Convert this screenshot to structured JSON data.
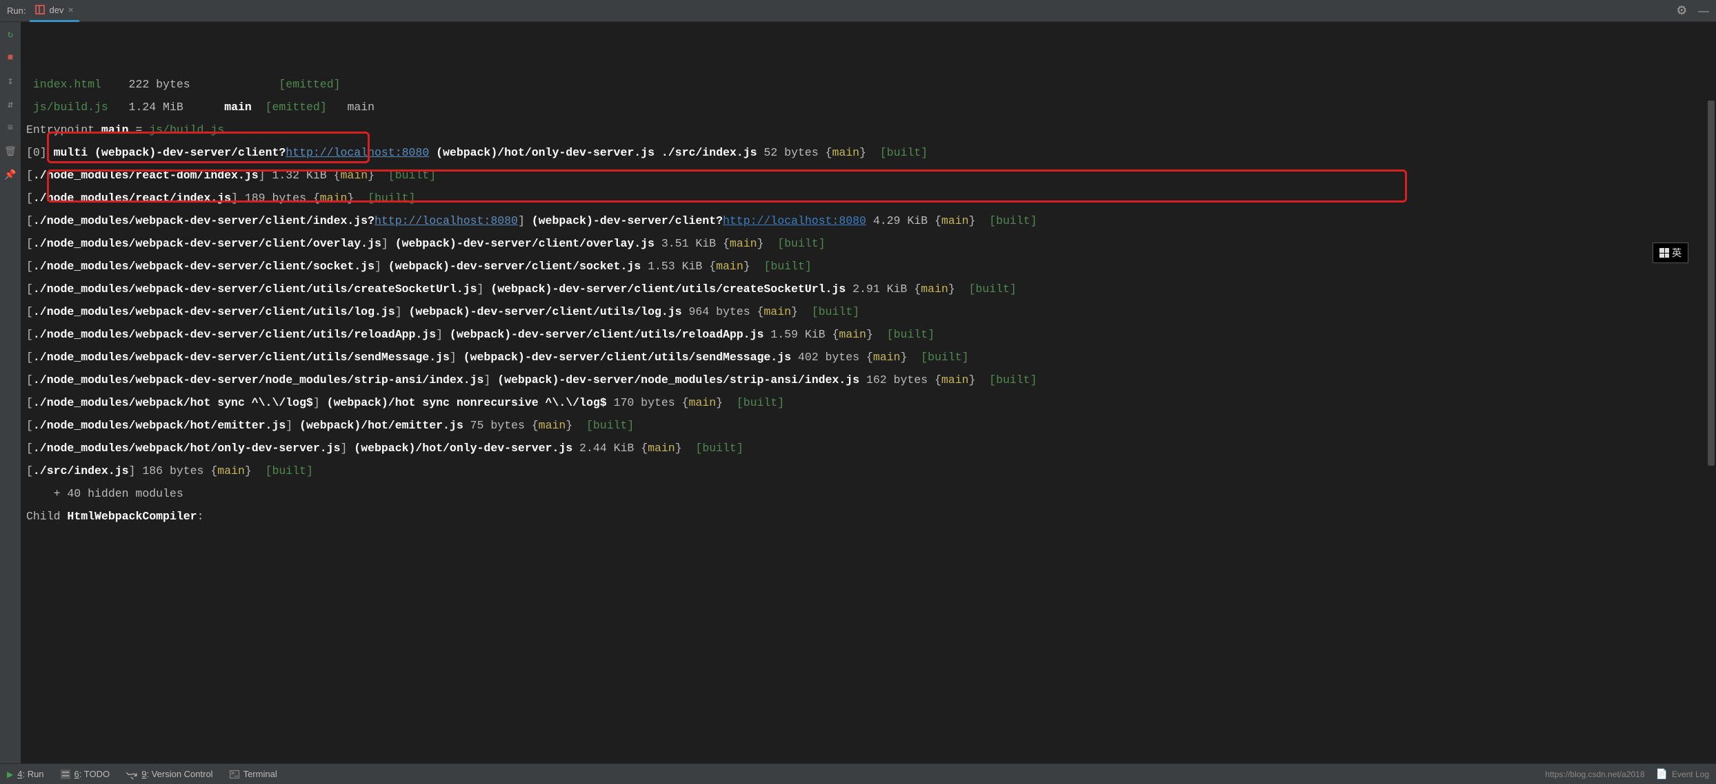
{
  "topBar": {
    "runLabel": "Run:",
    "tab": {
      "name": "dev",
      "closeGlyph": "×"
    },
    "gearGlyph": "⚙",
    "minimizeGlyph": "—"
  },
  "gutter": {
    "rerun": "↻",
    "stop": "■",
    "down": "↧",
    "layout": "⇵",
    "stack": "≡",
    "trash": "🗑",
    "pin": "📌"
  },
  "ime": {
    "label": "英"
  },
  "console": {
    "assets": [
      {
        "name": "index.html",
        "size": "222 bytes",
        "chunk": "",
        "status": "[emitted]",
        "extra": ""
      },
      {
        "name": "js/build.js",
        "size": "1.24 MiB",
        "chunk": "main",
        "status": "[emitted]",
        "extra": "main"
      }
    ],
    "entrypoint": {
      "prefix": "Entrypoint ",
      "name": "main",
      "eq": " = ",
      "file": "js/build.js"
    },
    "multiLine": {
      "idx": "[0]",
      "pre": " multi (webpack)-dev-server/client?",
      "url": "http://localhost:8080",
      "mid": " (webpack)/hot/only-dev-server.js ./src/index.js",
      "size": " 52 bytes ",
      "chunk": "main",
      "status": "[built]"
    },
    "modules": [
      {
        "path": "./node_modules/react-dom/index.js",
        "alias": "",
        "url": "",
        "post": "",
        "size": " 1.32 KiB ",
        "chunk": "main",
        "status": "[built]"
      },
      {
        "path": "./node_modules/react/index.js",
        "alias": "",
        "url": "",
        "post": "",
        "size": " 189 bytes ",
        "chunk": "main",
        "status": "[built]"
      },
      {
        "path": "./node_modules/webpack-dev-server/client/index.js?",
        "alias": " (webpack)-dev-server/client?",
        "url": "http://localhost:8080",
        "post": "",
        "url2": "http://localhost:8080",
        "size": " 4.29 KiB ",
        "chunk": "main",
        "status": "[built]"
      },
      {
        "path": "./node_modules/webpack-dev-server/client/overlay.js",
        "alias": " (webpack)-dev-server/client/overlay.js",
        "url": "",
        "post": "",
        "size": " 3.51 KiB ",
        "chunk": "main",
        "status": "[built]"
      },
      {
        "path": "./node_modules/webpack-dev-server/client/socket.js",
        "alias": " (webpack)-dev-server/client/socket.js",
        "url": "",
        "post": "",
        "size": " 1.53 KiB ",
        "chunk": "main",
        "status": "[built]"
      },
      {
        "path": "./node_modules/webpack-dev-server/client/utils/createSocketUrl.js",
        "alias": " (webpack)-dev-server/client/utils/createSocketUrl.js",
        "url": "",
        "post": "",
        "size": " 2.91 KiB ",
        "chunk": "main",
        "status": "[built]"
      },
      {
        "path": "./node_modules/webpack-dev-server/client/utils/log.js",
        "alias": " (webpack)-dev-server/client/utils/log.js",
        "url": "",
        "post": "",
        "size": " 964 bytes ",
        "chunk": "main",
        "status": "[built]"
      },
      {
        "path": "./node_modules/webpack-dev-server/client/utils/reloadApp.js",
        "alias": " (webpack)-dev-server/client/utils/reloadApp.js",
        "url": "",
        "post": "",
        "size": " 1.59 KiB ",
        "chunk": "main",
        "status": "[built]"
      },
      {
        "path": "./node_modules/webpack-dev-server/client/utils/sendMessage.js",
        "alias": " (webpack)-dev-server/client/utils/sendMessage.js",
        "url": "",
        "post": "",
        "size": " 402 bytes ",
        "chunk": "main",
        "status": "[built]"
      },
      {
        "path": "./node_modules/webpack-dev-server/node_modules/strip-ansi/index.js",
        "alias": " (webpack)-dev-server/node_modules/strip-ansi/index.js",
        "url": "",
        "post": "",
        "size": " 162 bytes ",
        "chunk": "main",
        "status": "[built]"
      },
      {
        "path": "./node_modules/webpack/hot sync ^\\.\\/log$",
        "alias": " (webpack)/hot sync nonrecursive ^\\.\\/log$",
        "url": "",
        "post": "",
        "size": " 170 bytes ",
        "chunk": "main",
        "status": "[built]"
      },
      {
        "path": "./node_modules/webpack/hot/emitter.js",
        "alias": " (webpack)/hot/emitter.js",
        "url": "",
        "post": "",
        "size": " 75 bytes ",
        "chunk": "main",
        "status": "[built]"
      },
      {
        "path": "./node_modules/webpack/hot/only-dev-server.js",
        "alias": " (webpack)/hot/only-dev-server.js",
        "url": "",
        "post": "",
        "size": " 2.44 KiB ",
        "chunk": "main",
        "status": "[built]"
      },
      {
        "path": "./src/index.js",
        "alias": "",
        "url": "",
        "post": "",
        "size": " 186 bytes ",
        "chunk": "main",
        "status": "[built]"
      }
    ],
    "hidden": "    + 40 hidden modules",
    "child": "Child HtmlWebpackCompiler:"
  },
  "statusBar": {
    "run": {
      "u": "4",
      "label": ": Run"
    },
    "todo": {
      "u": "6",
      "label": ": TODO"
    },
    "vcs": {
      "u": "9",
      "label": ": Version Control"
    },
    "terminal": "Terminal",
    "watermark": "https://blog.csdn.net/a2018",
    "eventLog": "Event Log"
  }
}
